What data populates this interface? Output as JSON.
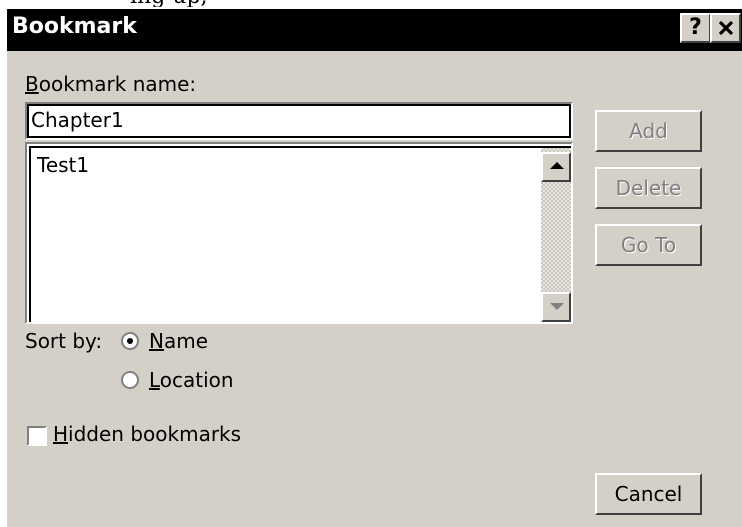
{
  "dialog": {
    "title": "Bookmark",
    "help_glyph": "?",
    "close_glyph": "✕"
  },
  "bookmark_name": {
    "label_mnemonic": "B",
    "label_rest": "ookmark name:",
    "value": "Chapter1"
  },
  "bookmark_list": {
    "items": [
      "Test1"
    ]
  },
  "buttons": {
    "add": "Add",
    "delete": "Delete",
    "goto": "Go To",
    "cancel": "Cancel"
  },
  "sort": {
    "label": "Sort by:",
    "name_mnemonic": "N",
    "name_rest": "ame",
    "location_mnemonic": "L",
    "location_rest": "ocation",
    "selected": "Name"
  },
  "hidden_bookmarks": {
    "mnemonic": "H",
    "rest": "idden bookmarks",
    "checked": false
  }
}
